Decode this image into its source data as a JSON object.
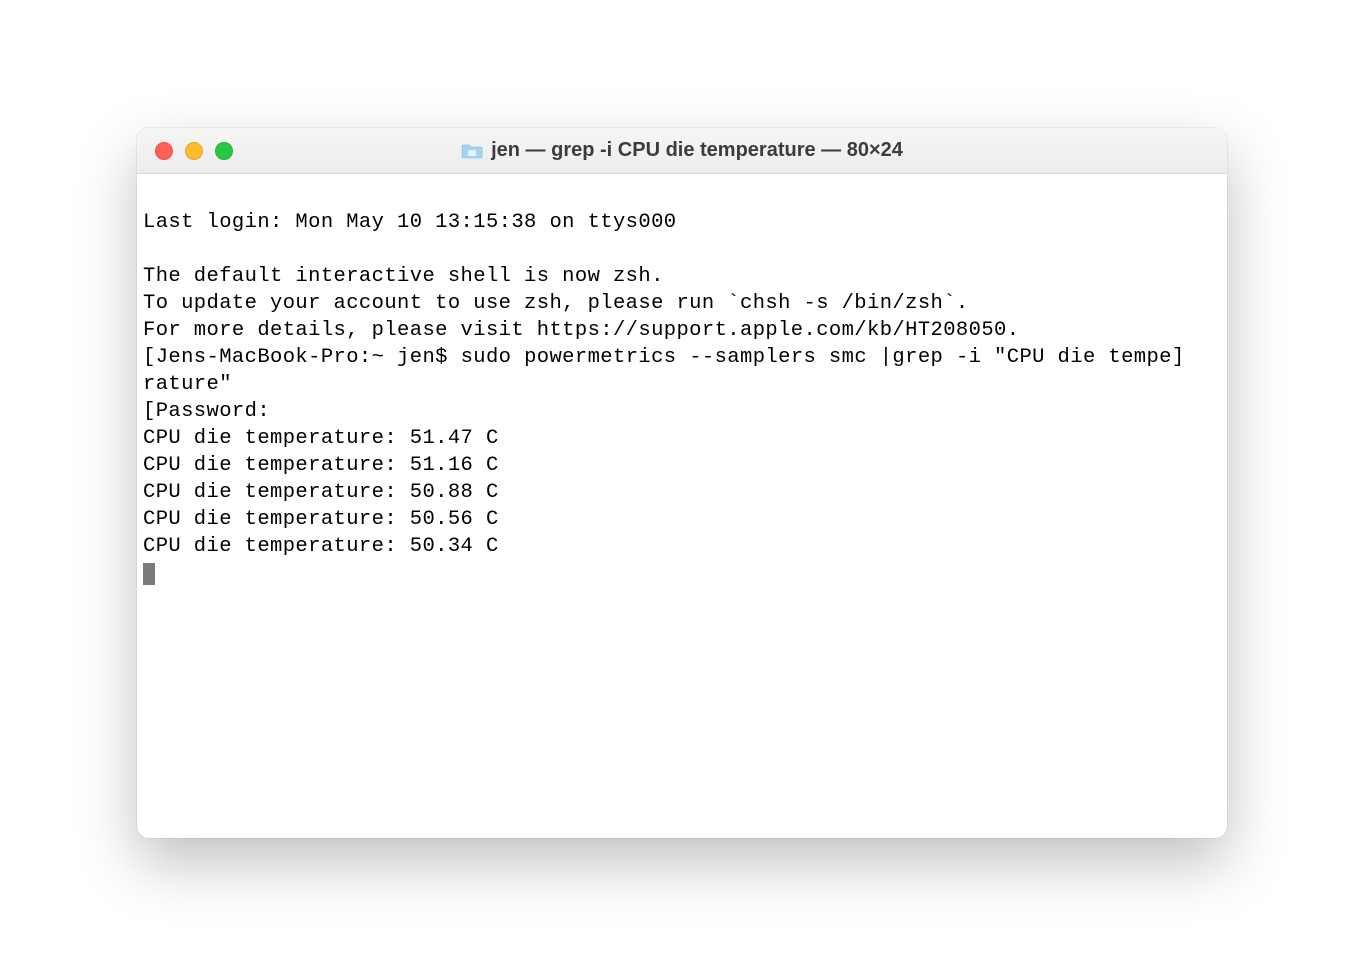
{
  "window": {
    "title": "jen — grep -i CPU die temperature — 80×24"
  },
  "terminal": {
    "last_login": "Last login: Mon May 10 13:15:38 on ttys000",
    "blank1": "",
    "zsh_notice1": "The default interactive shell is now zsh.",
    "zsh_notice2": "To update your account to use zsh, please run `chsh -s /bin/zsh`.",
    "zsh_notice3": "For more details, please visit https://support.apple.com/kb/HT208050.",
    "prompt_prefix": "[Jens-MacBook-Pro:~ jen$ ",
    "command": "sudo powermetrics --samplers smc |grep -i \"CPU die tempe]\nrature\"",
    "password_line": "[Password:",
    "password_suffix_bracket": "]",
    "output": [
      "CPU die temperature: 51.47 C",
      "CPU die temperature: 51.16 C",
      "CPU die temperature: 50.88 C",
      "CPU die temperature: 50.56 C",
      "CPU die temperature: 50.34 C"
    ]
  }
}
